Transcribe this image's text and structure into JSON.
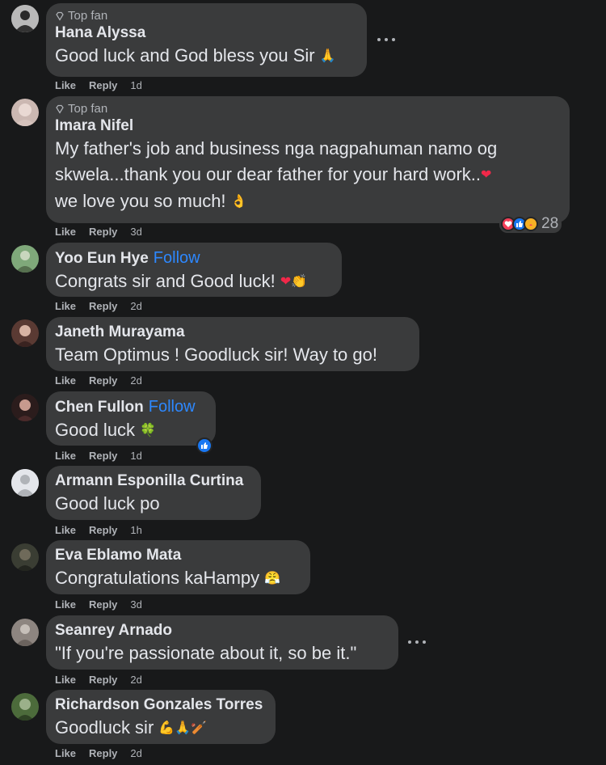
{
  "actions": {
    "like": "Like",
    "reply": "Reply"
  },
  "comments": [
    {
      "badge": "Top fan",
      "name": "Hana Alyssa",
      "text": "Good luck and God bless you Sir",
      "emoji": "🙏",
      "time": "1d"
    },
    {
      "badge": "Top fan",
      "name": "Imara Nifel",
      "text_lines": [
        "My father's job and business nga nagpahuman namo og",
        "skwela...thank you our dear father for your hard work..",
        "we love you so much!"
      ],
      "emoji1": "❤",
      "emoji2": "👌",
      "time": "3d",
      "reaction_count": "28"
    },
    {
      "name": "Yoo Eun Hye",
      "follow": "Follow",
      "text": "Congrats sir and Good luck!",
      "emoji": "❤👏",
      "time": "2d"
    },
    {
      "name": "Janeth Murayama",
      "text": "Team Optimus ! Goodluck sir! Way to go!",
      "time": "2d"
    },
    {
      "name": "Chen Fullon",
      "follow": "Follow",
      "text": "Good luck",
      "emoji": "🍀",
      "time": "1d"
    },
    {
      "name": "Armann Esponilla Curtina",
      "text": "Good luck po",
      "time": "1h"
    },
    {
      "name": "Eva Eblamo Mata",
      "text": "Congratulations kaHampy",
      "emoji": "😤",
      "time": "3d"
    },
    {
      "name": "Seanrey Arnado",
      "text": "\"If you're passionate about it, so be it.\"",
      "time": "2d"
    },
    {
      "name": "Richardson Gonzales Torres",
      "text": "Goodluck sir",
      "emoji": "💪🙏🏏",
      "time": "2d"
    }
  ],
  "colors": {
    "background": "#18191a",
    "bubble": "#3a3b3c",
    "follow": "#2d88ff",
    "secondary_text": "#b0b3b8"
  }
}
